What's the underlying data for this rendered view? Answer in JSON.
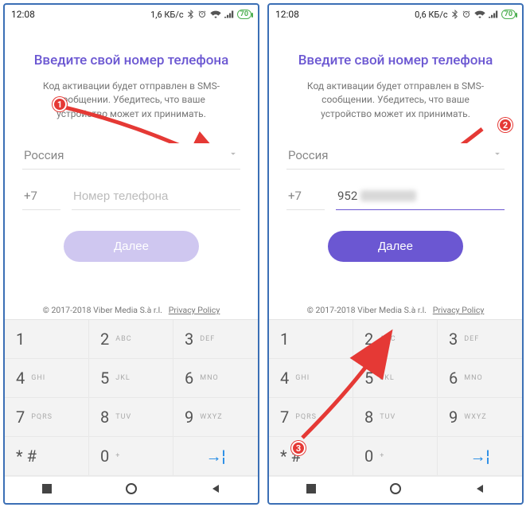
{
  "status": {
    "time": "12:08",
    "net1": "1,6 КБ/с",
    "net2": "0,6 КБ/с",
    "battery": "70"
  },
  "screen": {
    "title": "Введите свой номер телефона",
    "subtitle": "Код активации будет отправлен в SMS-сообщении. Убедитесь, что ваше устройство может их принимать.",
    "country": "Россия",
    "dial_code": "+7",
    "phone_placeholder": "Номер телефона",
    "phone_value": "952",
    "next": "Далее",
    "footer_copyright": "© 2017-2018 Viber Media S.à r.l.",
    "footer_privacy": "Privacy Policy"
  },
  "keypad": {
    "k1": "1",
    "k2": "2",
    "k2s": "ABC",
    "k3": "3",
    "k3s": "DEF",
    "k4": "4",
    "k4s": "GHI",
    "k5": "5",
    "k5s": "JKL",
    "k6": "6",
    "k6s": "MNO",
    "k7": "7",
    "k7s": "PQRS",
    "k8": "8",
    "k8s": "TUV",
    "k9": "9",
    "k9s": "WXYZ",
    "kstar": "* #",
    "k0": "0",
    "k0s": "+"
  },
  "annotations": {
    "b1": "1",
    "b2": "2",
    "b3": "3"
  }
}
